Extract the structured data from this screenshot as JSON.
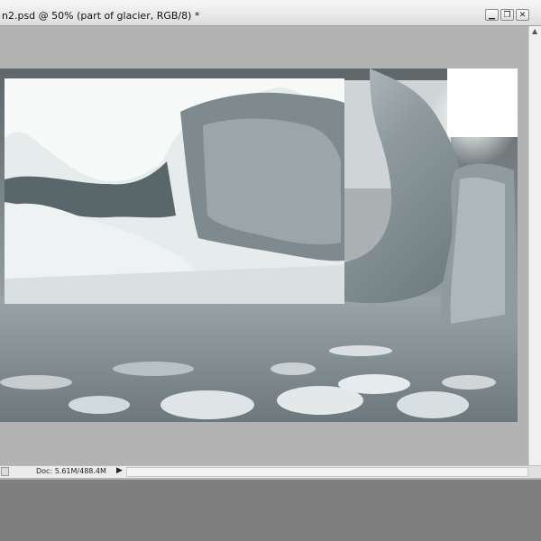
{
  "window": {
    "title": "n2.psd @ 50% (part of glacier, RGB/8) *",
    "buttons": {
      "minimize": "minimize-icon",
      "restore": "restore-icon",
      "close": "close-icon"
    },
    "close_glyph": "✕",
    "restore_glyph": "❐",
    "minimize_glyph": "▁"
  },
  "status_bar": {
    "doc_info": "Doc: 5.61M/488.4M",
    "menu_arrow": "▶"
  },
  "canvas": {
    "subject": "glacier ice arch and floating ice floes"
  },
  "colors": {
    "workspace": "#b3b3b3",
    "app_background": "#7f7f7f",
    "ice_light": "#e8eeee",
    "ice_dark": "#6f7c80"
  }
}
